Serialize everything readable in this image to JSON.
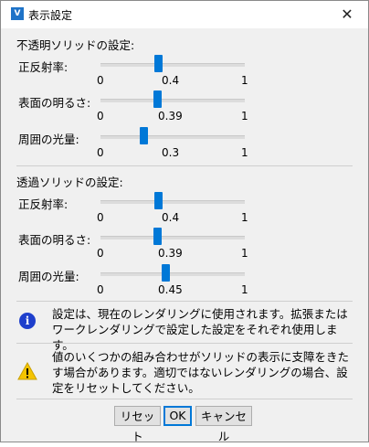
{
  "window": {
    "title": "表示設定",
    "app_icon_glyph": "V",
    "close_glyph": "✕"
  },
  "opaque": {
    "title": "不透明ソリッドの設定:",
    "rows": [
      {
        "label": "正反射率:",
        "min": "0",
        "max": "1",
        "value_text": "0.4",
        "value": 0.4
      },
      {
        "label": "表面の明るさ:",
        "min": "0",
        "max": "1",
        "value_text": "0.39",
        "value": 0.39
      },
      {
        "label": "周囲の光量:",
        "min": "0",
        "max": "1",
        "value_text": "0.3",
        "value": 0.3
      }
    ]
  },
  "transparent": {
    "title": "透過ソリッドの設定:",
    "rows": [
      {
        "label": "正反射率:",
        "min": "0",
        "max": "1",
        "value_text": "0.4",
        "value": 0.4
      },
      {
        "label": "表面の明るさ:",
        "min": "0",
        "max": "1",
        "value_text": "0.39",
        "value": 0.39
      },
      {
        "label": "周囲の光量:",
        "min": "0",
        "max": "1",
        "value_text": "0.45",
        "value": 0.45
      }
    ]
  },
  "messages": {
    "info_icon": "info-icon",
    "info_text": "設定は、現在のレンダリングに使用されます。拡張またはワークレンダリングで設定した設定をそれぞれ使用します。",
    "warning_icon": "warning-icon",
    "warning_text": "値のいくつかの組み合わせがソリッドの表示に支障をきたす場合があります。適切ではないレンダリングの場合、設定をリセットしてください。"
  },
  "buttons": {
    "reset": "リセット",
    "ok": "OK",
    "cancel": "キャンセル"
  },
  "colors": {
    "accent": "#0078d7",
    "info": "#1e3fcc",
    "warning": "#f5c400"
  }
}
